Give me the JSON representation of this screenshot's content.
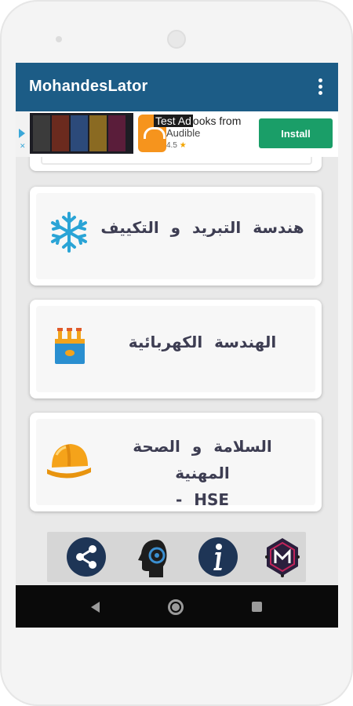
{
  "app": {
    "title": "MohandesLator"
  },
  "ad": {
    "title_prefix": "Test Ad",
    "title_rest": "ooks from",
    "subtitle": "Audible",
    "rating": "4.5",
    "star": "★",
    "install_label": "Install"
  },
  "categories": [
    {
      "label": "هندسة التبريد و التكييف",
      "icon": "snowflake-icon"
    },
    {
      "label": "الهندسة الكهربائية",
      "icon": "electrical-transformer-icon"
    },
    {
      "label_line1": "السلامة و الصحة المهنية",
      "label_line2": "HSE -",
      "icon": "safety-helmet-icon"
    }
  ],
  "bottom_bar": [
    {
      "icon": "share-icon"
    },
    {
      "icon": "profile-head-icon"
    },
    {
      "icon": "info-icon"
    },
    {
      "icon": "app-logo-icon"
    }
  ],
  "colors": {
    "appbar": "#1c5c86",
    "install": "#1a9e68",
    "icon_blue": "#1e5f92",
    "snowflake": "#2aa4d6",
    "helmet": "#f5a31a"
  }
}
